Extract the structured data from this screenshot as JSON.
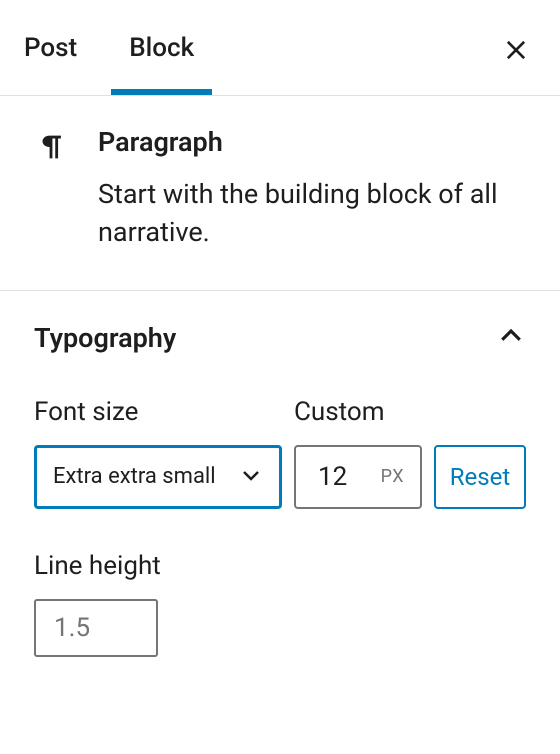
{
  "tabs": {
    "post": "Post",
    "block": "Block"
  },
  "blockHeader": {
    "title": "Paragraph",
    "description": "Start with the building block of all narrative."
  },
  "typography": {
    "panelTitle": "Typography",
    "fontSize": {
      "label": "Font size",
      "selected": "Extra extra small"
    },
    "custom": {
      "label": "Custom",
      "value": "12",
      "unit": "PX"
    },
    "resetLabel": "Reset",
    "lineHeight": {
      "label": "Line height",
      "placeholder": "1.5"
    }
  }
}
